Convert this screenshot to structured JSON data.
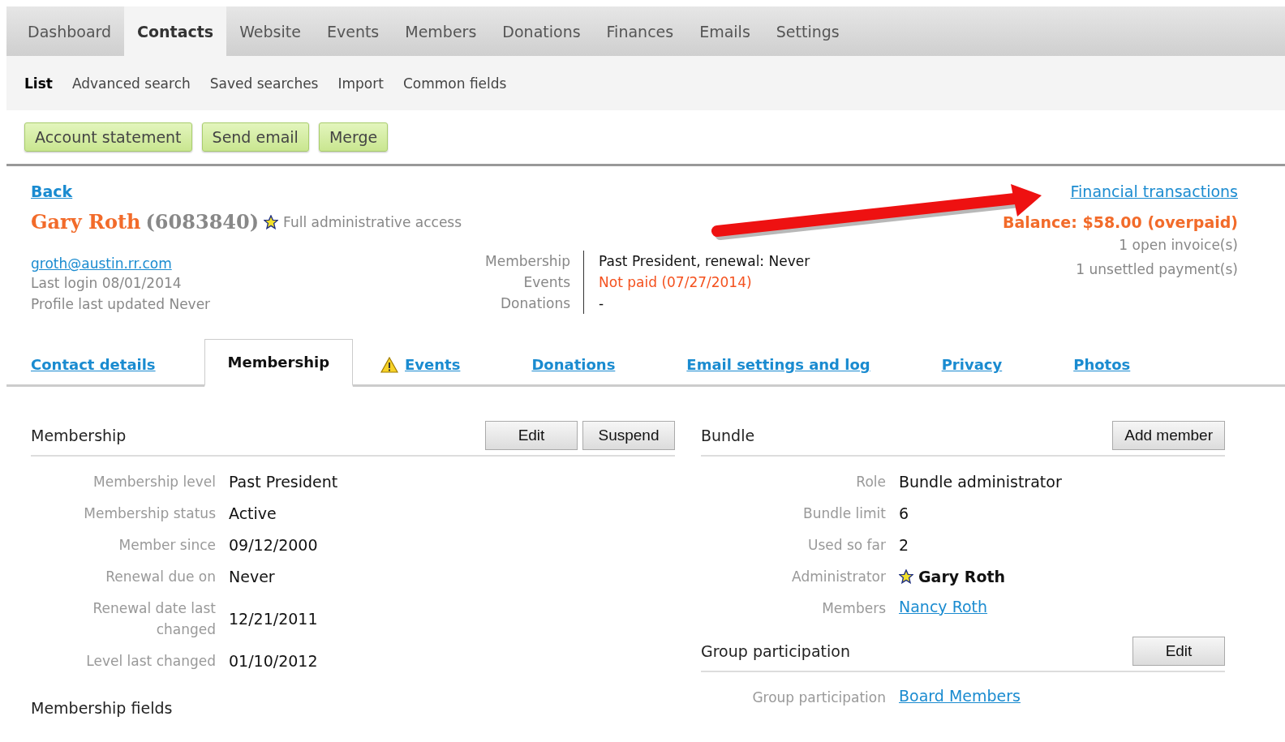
{
  "main_nav": [
    {
      "label": "Dashboard",
      "selected": false
    },
    {
      "label": "Contacts",
      "selected": true
    },
    {
      "label": "Website",
      "selected": false
    },
    {
      "label": "Events",
      "selected": false
    },
    {
      "label": "Members",
      "selected": false
    },
    {
      "label": "Donations",
      "selected": false
    },
    {
      "label": "Finances",
      "selected": false
    },
    {
      "label": "Emails",
      "selected": false
    },
    {
      "label": "Settings",
      "selected": false
    }
  ],
  "sub_nav": [
    {
      "label": "List",
      "selected": true
    },
    {
      "label": "Advanced search",
      "selected": false
    },
    {
      "label": "Saved searches",
      "selected": false
    },
    {
      "label": "Import",
      "selected": false
    },
    {
      "label": "Common fields",
      "selected": false
    }
  ],
  "actions": [
    "Account statement",
    "Send email",
    "Merge"
  ],
  "contact": {
    "back": "Back",
    "name": "Gary Roth",
    "id": "(6083840)",
    "access": "Full administrative access",
    "email": "groth@austin.rr.com",
    "last_login": "Last login 08/01/2014",
    "profile_updated": "Profile last updated Never"
  },
  "summary": [
    {
      "label": "Membership",
      "value": "Past President, renewal: Never",
      "alert": false
    },
    {
      "label": "Events",
      "value": "Not paid (07/27/2014)",
      "alert": true
    },
    {
      "label": "Donations",
      "value": "-",
      "alert": false
    }
  ],
  "finance": {
    "link": "Financial transactions",
    "balance": "Balance: $58.00 (overpaid)",
    "lines": [
      "1 open invoice(s)",
      "1 unsettled payment(s)"
    ]
  },
  "tabs": [
    {
      "label": "Contact details",
      "selected": false,
      "warning": false
    },
    {
      "label": "Membership",
      "selected": true,
      "warning": false
    },
    {
      "label": "Events",
      "selected": false,
      "warning": true
    },
    {
      "label": "Donations",
      "selected": false,
      "warning": false
    },
    {
      "label": "Email settings and log",
      "selected": false,
      "warning": false
    },
    {
      "label": "Privacy",
      "selected": false,
      "warning": false
    },
    {
      "label": "Photos",
      "selected": false,
      "warning": false
    }
  ],
  "membership": {
    "title": "Membership",
    "buttons": [
      "Edit",
      "Suspend"
    ],
    "fields": [
      {
        "label": "Membership level",
        "value": "Past President"
      },
      {
        "label": "Membership status",
        "value": "Active"
      },
      {
        "label": "Member since",
        "value": "09/12/2000"
      },
      {
        "label": "Renewal due on",
        "value": "Never"
      },
      {
        "label": "Renewal date last changed",
        "value": "12/21/2011"
      },
      {
        "label": "Level last changed",
        "value": "01/10/2012"
      }
    ]
  },
  "membership_fields": {
    "title": "Membership fields"
  },
  "bundle": {
    "title": "Bundle",
    "buttons": [
      "Add member"
    ],
    "fields": [
      {
        "label": "Role",
        "value": "Bundle administrator",
        "kind": "text"
      },
      {
        "label": "Bundle limit",
        "value": "6",
        "kind": "text"
      },
      {
        "label": "Used so far",
        "value": "2",
        "kind": "text"
      },
      {
        "label": "Administrator",
        "value": "Gary Roth",
        "kind": "admin"
      },
      {
        "label": "Members",
        "value": "Nancy Roth",
        "kind": "link"
      }
    ]
  },
  "group": {
    "title": "Group participation",
    "buttons": [
      "Edit"
    ],
    "fields": [
      {
        "label": "Group participation",
        "value": "Board Members",
        "kind": "link"
      }
    ]
  }
}
